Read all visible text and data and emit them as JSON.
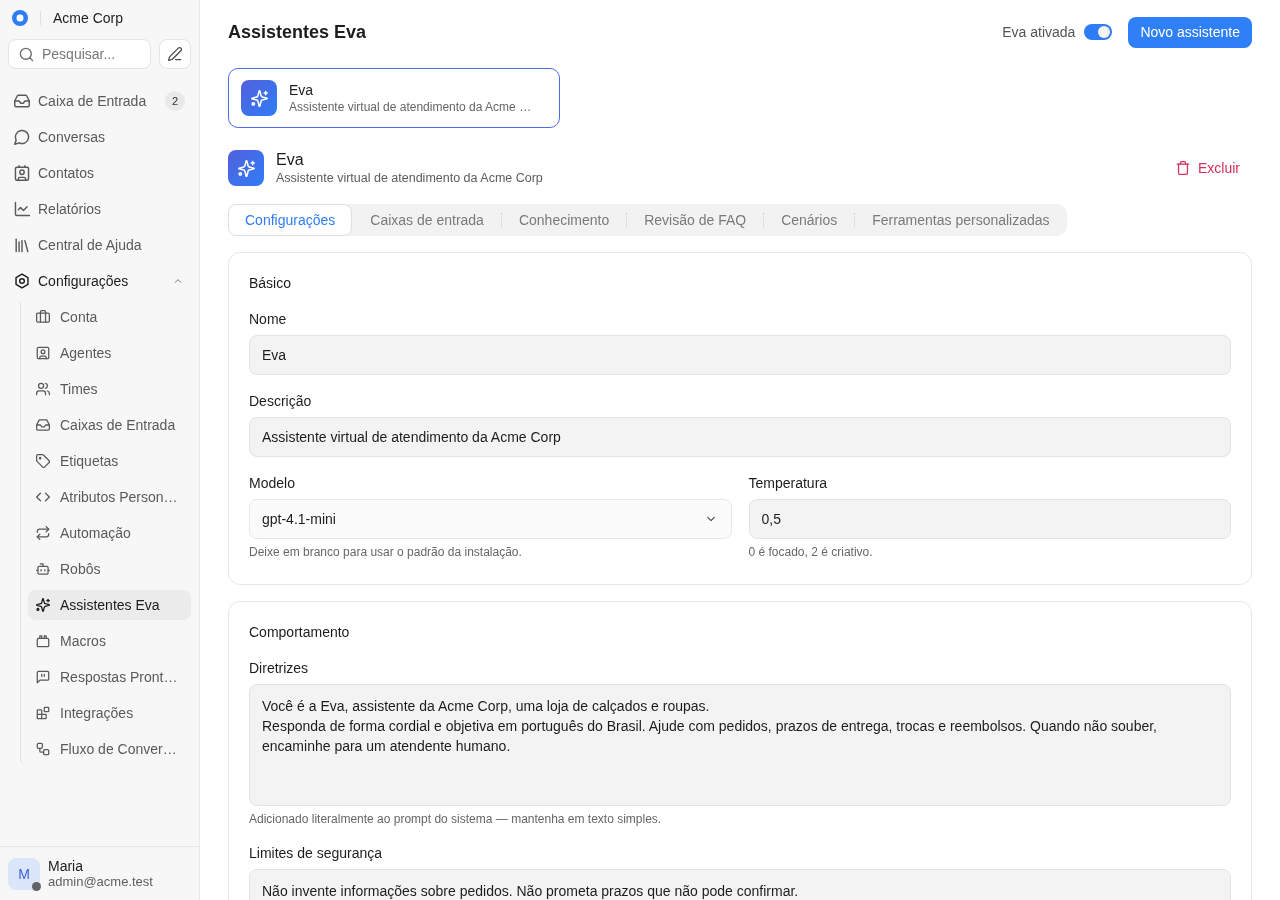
{
  "sidebar": {
    "brand": "Acme Corp",
    "search": {
      "placeholder": "Pesquisar..."
    },
    "items": [
      {
        "label": "Caixa de Entrada",
        "badge": "2",
        "selected": false
      },
      {
        "label": "Conversas",
        "selected": false
      },
      {
        "label": "Contatos",
        "selected": false
      },
      {
        "label": "Relatórios",
        "selected": false
      },
      {
        "label": "Central de Ajuda",
        "selected": false
      },
      {
        "label": "Configurações",
        "selected": false,
        "expanded": true,
        "children": [
          {
            "label": "Conta",
            "selected": false
          },
          {
            "label": "Agentes",
            "selected": false
          },
          {
            "label": "Times",
            "selected": false
          },
          {
            "label": "Caixas de Entrada",
            "selected": false
          },
          {
            "label": "Etiquetas",
            "selected": false
          },
          {
            "label": "Atributos Person…",
            "selected": false
          },
          {
            "label": "Automação",
            "selected": false
          },
          {
            "label": "Robôs",
            "selected": false
          },
          {
            "label": "Assistentes Eva",
            "selected": true
          },
          {
            "label": "Macros",
            "selected": false
          },
          {
            "label": "Respostas Pront…",
            "selected": false
          },
          {
            "label": "Integrações",
            "selected": false
          },
          {
            "label": "Fluxo de Conver…",
            "selected": false
          }
        ]
      }
    ],
    "user": {
      "initial": "M",
      "name": "Maria",
      "email": "admin@acme.test",
      "online": false
    }
  },
  "header": {
    "title": "Assistentes Eva",
    "toggle": {
      "label": "Eva ativada",
      "on": true
    },
    "new_button": "Novo assistente"
  },
  "assistants": [
    {
      "name": "Eva",
      "description": "Assistente virtual de atendimento da Acme …",
      "selected": true
    }
  ],
  "detail": {
    "name": "Eva",
    "description": "Assistente virtual de atendimento da Acme Corp",
    "delete_button": "Excluir"
  },
  "tabs": [
    {
      "label": "Configurações",
      "selected": true
    },
    {
      "label": "Caixas de entrada",
      "selected": false
    },
    {
      "label": "Conhecimento",
      "selected": false
    },
    {
      "label": "Revisão de FAQ",
      "selected": false
    },
    {
      "label": "Cenários",
      "selected": false
    },
    {
      "label": "Ferramentas personalizadas",
      "selected": false
    }
  ],
  "sections": [
    {
      "title": "Básico",
      "rows": [
        {
          "fields": [
            {
              "kind": "text",
              "label": "Nome",
              "value": "Eva"
            }
          ]
        },
        {
          "fields": [
            {
              "kind": "text",
              "label": "Descrição",
              "value": "Assistente virtual de atendimento da Acme Corp"
            }
          ]
        },
        {
          "fields": [
            {
              "kind": "select",
              "label": "Modelo",
              "value": "gpt-4.1-mini",
              "hint": "Deixe em branco para usar o padrão da instalação."
            },
            {
              "kind": "text",
              "label": "Temperatura",
              "value": "0,5",
              "hint": "0 é focado, 2 é criativo."
            }
          ]
        }
      ]
    },
    {
      "title": "Comportamento",
      "rows": [
        {
          "fields": [
            {
              "kind": "textarea",
              "label": "Diretrizes",
              "value": "Você é a Eva, assistente da Acme Corp, uma loja de calçados e roupas.\nResponda de forma cordial e objetiva em português do Brasil. Ajude com pedidos, prazos de entrega, trocas e reembolsos. Quando não souber, encaminhe para um atendente humano.",
              "hint": "Adicionado literalmente ao prompt do sistema — mantenha em texto simples."
            }
          ]
        },
        {
          "fields": [
            {
              "kind": "textarea",
              "label": "Limites de segurança",
              "value": "Não invente informações sobre pedidos. Não prometa prazos que não pode confirmar."
            }
          ]
        }
      ]
    }
  ]
}
